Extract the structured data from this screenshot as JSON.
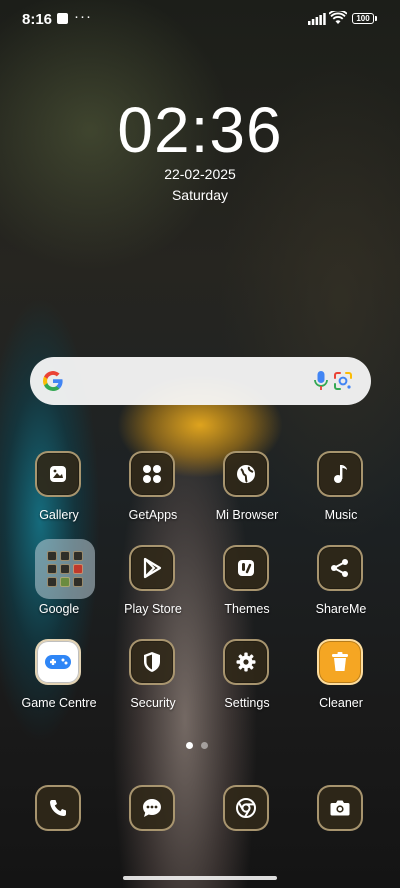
{
  "status_bar": {
    "time": "8:16",
    "notification_dots": "···",
    "battery": "100",
    "icons": [
      "notification-square-icon",
      "signal-icon",
      "wifi-icon",
      "battery-icon"
    ]
  },
  "clock_widget": {
    "time": "02:36",
    "date": "22-02-2025",
    "day": "Saturday"
  },
  "search_bar": {
    "icons": [
      "google-logo-icon",
      "microphone-icon",
      "google-lens-icon"
    ]
  },
  "apps": [
    {
      "label": "Gallery",
      "icon": "gallery-icon"
    },
    {
      "label": "GetApps",
      "icon": "getapps-icon"
    },
    {
      "label": "Mi Browser",
      "icon": "globe-icon"
    },
    {
      "label": "Music",
      "icon": "music-note-icon"
    },
    {
      "label": "Google",
      "icon": "folder-icon"
    },
    {
      "label": "Play Store",
      "icon": "play-store-icon"
    },
    {
      "label": "Themes",
      "icon": "themes-icon"
    },
    {
      "label": "ShareMe",
      "icon": "share-icon"
    },
    {
      "label": "Game Centre",
      "icon": "gamepad-icon"
    },
    {
      "label": "Security",
      "icon": "shield-icon"
    },
    {
      "label": "Settings",
      "icon": "gear-icon"
    },
    {
      "label": "Cleaner",
      "icon": "trash-bin-icon"
    }
  ],
  "page_indicator": {
    "pages": 2,
    "current": 1
  },
  "dock": [
    {
      "icon": "phone-icon"
    },
    {
      "icon": "message-icon"
    },
    {
      "icon": "chrome-icon"
    },
    {
      "icon": "camera-icon"
    }
  ],
  "colors": {
    "tile_bg": "#302818",
    "tile_border": "#d2b98c",
    "search_bg": "#f8f8f8",
    "google_blue": "#4285F4",
    "google_red": "#EA4335",
    "google_yellow": "#FBBC05",
    "google_green": "#34A853",
    "cleaner_orange": "#F5A623"
  }
}
